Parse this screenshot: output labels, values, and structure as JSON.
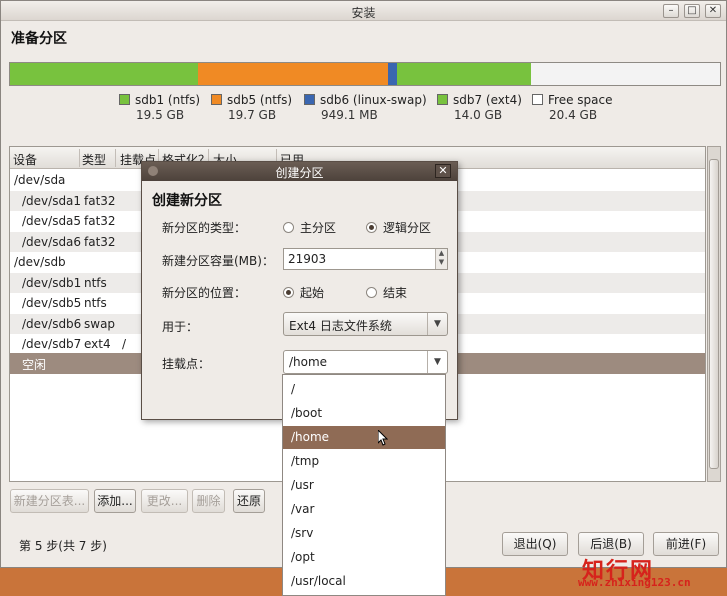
{
  "window": {
    "title": "安装",
    "heading": "准备分区"
  },
  "partition_bar": [
    {
      "name": "sdb1 (ntfs)",
      "size": "19.5 GB",
      "color": "#78c23e"
    },
    {
      "name": "sdb5 (ntfs)",
      "size": "19.7 GB",
      "color": "#f08a24"
    },
    {
      "name": "sdb6 (linux-swap)",
      "size": "949.1 MB",
      "color": "#3a66b0"
    },
    {
      "name": "sdb7 (ext4)",
      "size": "14.0 GB",
      "color": "#78c23e"
    },
    {
      "name": "Free space",
      "size": "20.4 GB",
      "color": "#ffffff"
    }
  ],
  "table": {
    "headers": [
      "设备",
      "类型",
      "挂载点",
      "格式化？",
      "大小",
      "已用"
    ],
    "rows": [
      {
        "device": "/dev/sda",
        "type": "",
        "mount": ""
      },
      {
        "device": "/dev/sda1",
        "type": "fat32",
        "mount": ""
      },
      {
        "device": "/dev/sda5",
        "type": "fat32",
        "mount": ""
      },
      {
        "device": "/dev/sda6",
        "type": "fat32",
        "mount": ""
      },
      {
        "device": "/dev/sdb",
        "type": "",
        "mount": ""
      },
      {
        "device": "/dev/sdb1",
        "type": "ntfs",
        "mount": ""
      },
      {
        "device": "/dev/sdb5",
        "type": "ntfs",
        "mount": ""
      },
      {
        "device": "/dev/sdb6",
        "type": "swap",
        "mount": ""
      },
      {
        "device": "/dev/sdb7",
        "type": "ext4",
        "mount": "/"
      },
      {
        "device": "空闲",
        "type": "",
        "mount": ""
      }
    ]
  },
  "actions": {
    "new_table": "新建分区表...",
    "add": "添加...",
    "change": "更改...",
    "delete": "删除",
    "revert": "还原"
  },
  "footer": {
    "steps": "第 5 步(共 7 步)",
    "quit": "退出(Q)",
    "back": "后退(B)",
    "forward": "前进(F)"
  },
  "dialog": {
    "title": "创建分区",
    "heading": "创建新分区",
    "type_label": "新分区的类型：",
    "type_primary": "主分区",
    "type_logical": "逻辑分区",
    "size_label": "新建分区容量(MB)：",
    "size_value": "21903",
    "location_label": "新分区的位置：",
    "location_begin": "起始",
    "location_end": "结束",
    "use_label": "用于：",
    "use_value": "Ext4 日志文件系统",
    "mount_label": "挂载点：",
    "mount_value": "/home"
  },
  "mount_options": [
    "/",
    "/boot",
    "/home",
    "/tmp",
    "/usr",
    "/var",
    "/srv",
    "/opt",
    "/usr/local"
  ],
  "watermark": {
    "text": "知行网",
    "url": "www.zhixing123.cn"
  }
}
